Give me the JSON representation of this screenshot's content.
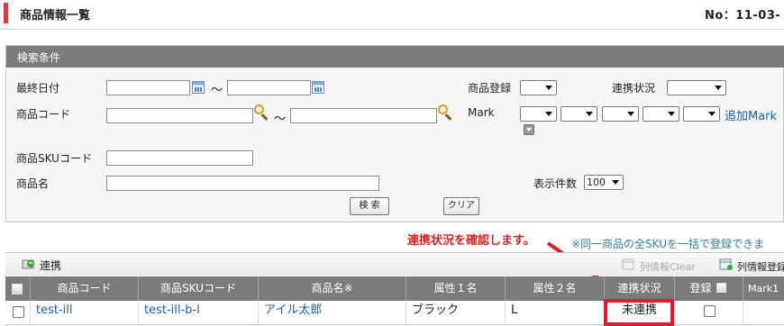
{
  "header": {
    "title": "商品情報一覧",
    "record_no": "No：11-03-"
  },
  "search": {
    "panel_title": "検索条件",
    "last_date_label": "最終日付",
    "tilde": "～",
    "product_code_label": "商品コード",
    "product_sku_label": "商品SKUコード",
    "product_name_label": "商品名",
    "product_registration_label": "商品登録",
    "link_status_label": "連携状況",
    "mark_label": "Mark",
    "add_mark_link": "追加Mark",
    "display_count_label": "表示件数",
    "display_count_value": "100",
    "search_button": "検 索",
    "clear_button": "クリア"
  },
  "annotation": {
    "callout": "連携状況を確認します。",
    "callout_color": "#e02020",
    "sku_note": "※同一商品の全SKUを一括で登録できま"
  },
  "toolbar": {
    "link_button": "連携",
    "column_info_clear": "列情報Clear",
    "column_info_register": "列情報登録"
  },
  "table": {
    "columns": [
      "商品コード",
      "商品SKUコード",
      "商品名※",
      "属性１名",
      "属性２名",
      "連携状況",
      "登録",
      "Mark1"
    ],
    "rows": [
      {
        "product_code": "test-ill",
        "sku_code": "test-ill-b-l",
        "product_name": "アイル太郎",
        "attr1": "ブラック",
        "attr2": "L",
        "link_status": "未連携"
      }
    ]
  }
}
